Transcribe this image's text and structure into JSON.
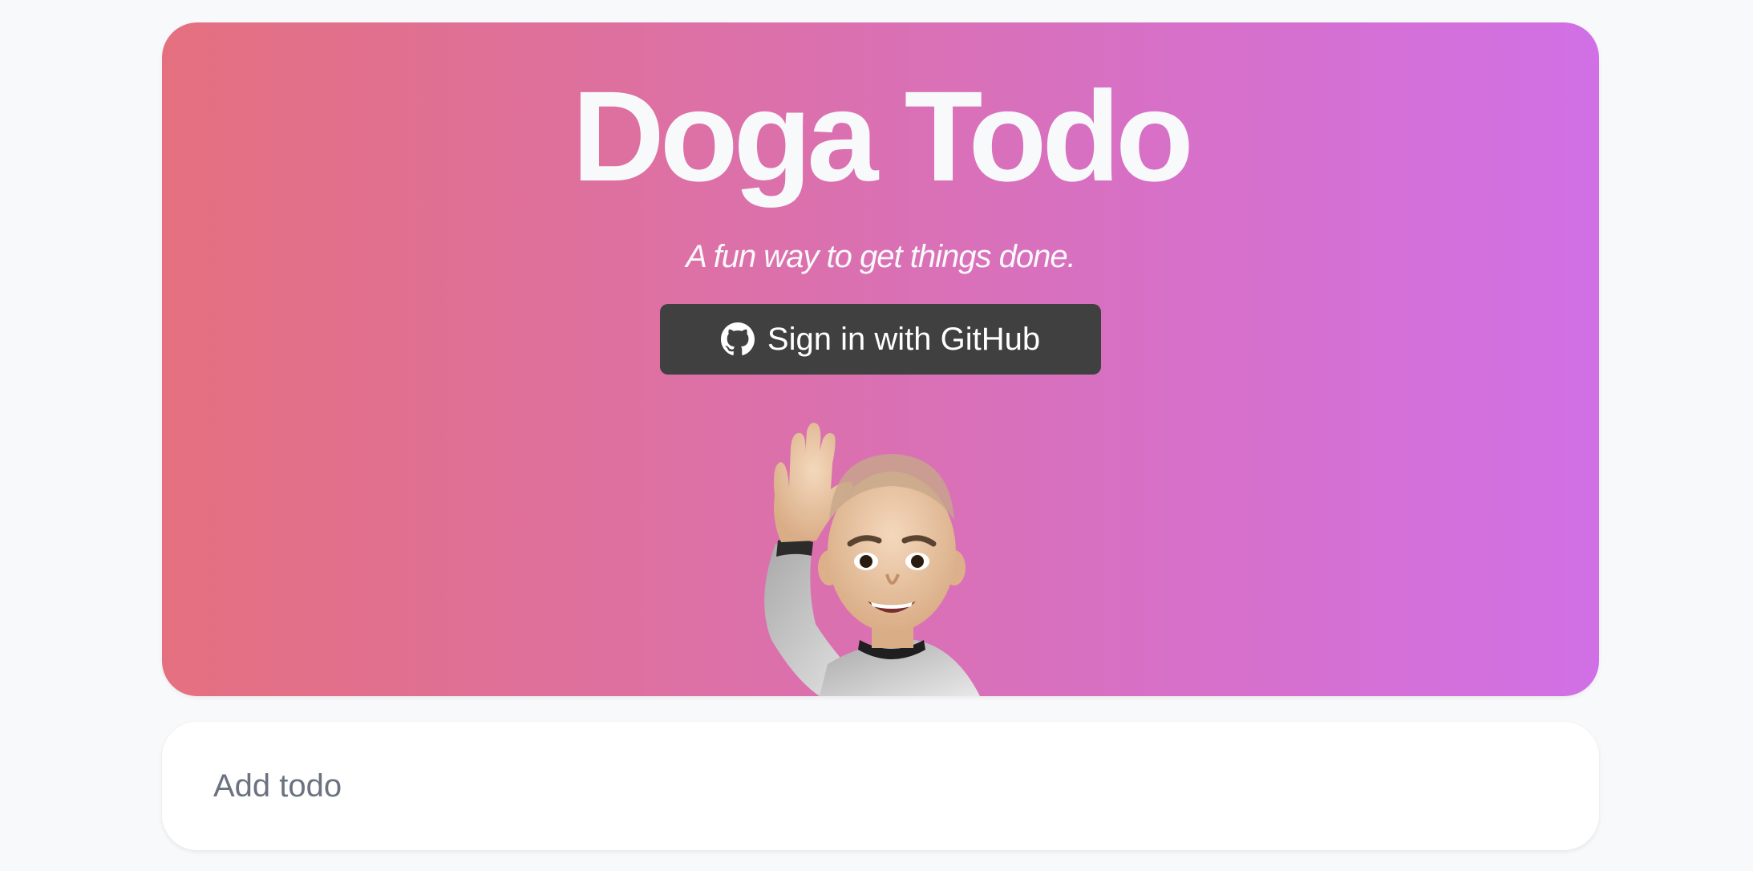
{
  "hero": {
    "title": "Doga Todo",
    "subtitle": "A fun way to get things done.",
    "gradient_start": "#e4707f",
    "gradient_end": "#d170e6",
    "text_color": "#f8f9fb"
  },
  "signin": {
    "label": "Sign in with GitHub",
    "icon": "github-icon",
    "background": "#404040",
    "text_color": "#ffffff"
  },
  "avatar": {
    "icon": "waving-memoji-avatar"
  },
  "add_todo": {
    "placeholder": "Add todo",
    "value": "",
    "background": "#ffffff"
  }
}
